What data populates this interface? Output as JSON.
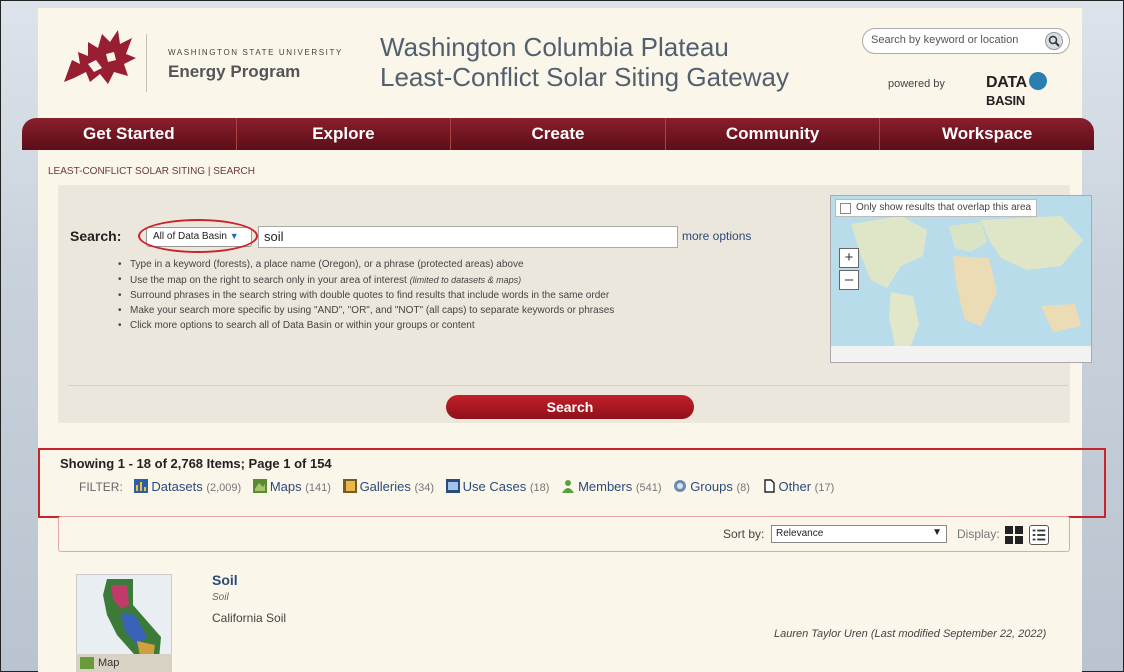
{
  "header": {
    "university": "WASHINGTON STATE UNIVERSITY",
    "program": "Energy Program",
    "title_line1": "Washington Columbia Plateau",
    "title_line2": "Least-Conflict Solar Siting Gateway",
    "top_search_placeholder": "Search by keyword or location",
    "powered_by": "powered by",
    "db_logo_left": "DATA",
    "db_logo_right": "BASIN",
    "brand_color": "#981e32"
  },
  "nav": {
    "items": [
      "Get Started",
      "Explore",
      "Create",
      "Community",
      "Workspace"
    ]
  },
  "breadcrumb": {
    "section": "LEAST-CONFLICT SOLAR SITING",
    "separator": " | ",
    "page": "SEARCH"
  },
  "search": {
    "label": "Search:",
    "scope": "All of Data Basin",
    "query": "soil",
    "more_options": "more options",
    "tips": [
      "Type in a keyword (forests), a place name (Oregon), or a phrase (protected areas) above",
      "Use the map on the right to search only in your area of interest",
      "Surround phrases in the search string with double quotes to find results that include words in the same order",
      "Make your search more specific by using \"AND\", \"OR\", and \"NOT\" (all caps) to separate keywords or phrases",
      "Click more options to search all of Data Basin or within your groups or content"
    ],
    "tip2_note": "(limited to datasets & maps)",
    "button": "Search",
    "map_overlap_label": "Only show results that overlap this area",
    "zoom_in": "+",
    "zoom_out": "–"
  },
  "results": {
    "summary": "Showing 1 - 18 of 2,768 Items; Page 1 of 154",
    "filter_label": "FILTER:",
    "filters": [
      {
        "label": "Datasets",
        "count": "(2,009)",
        "icon": "datasets-icon"
      },
      {
        "label": "Maps",
        "count": "(141)",
        "icon": "maps-icon"
      },
      {
        "label": "Galleries",
        "count": "(34)",
        "icon": "galleries-icon"
      },
      {
        "label": "Use Cases",
        "count": "(18)",
        "icon": "use-cases-icon"
      },
      {
        "label": "Members",
        "count": "(541)",
        "icon": "members-icon"
      },
      {
        "label": "Groups",
        "count": "(8)",
        "icon": "groups-icon"
      },
      {
        "label": "Other",
        "count": "(17)",
        "icon": "other-icon"
      }
    ],
    "sort_label": "Sort by:",
    "sort_value": "Relevance",
    "display_label": "Display:"
  },
  "item": {
    "title": "Soil",
    "subtitle": "Soil",
    "description": "California Soil",
    "author": "Lauren Taylor Uren (Last modified September 22, 2022)",
    "type_tag": "Map"
  }
}
